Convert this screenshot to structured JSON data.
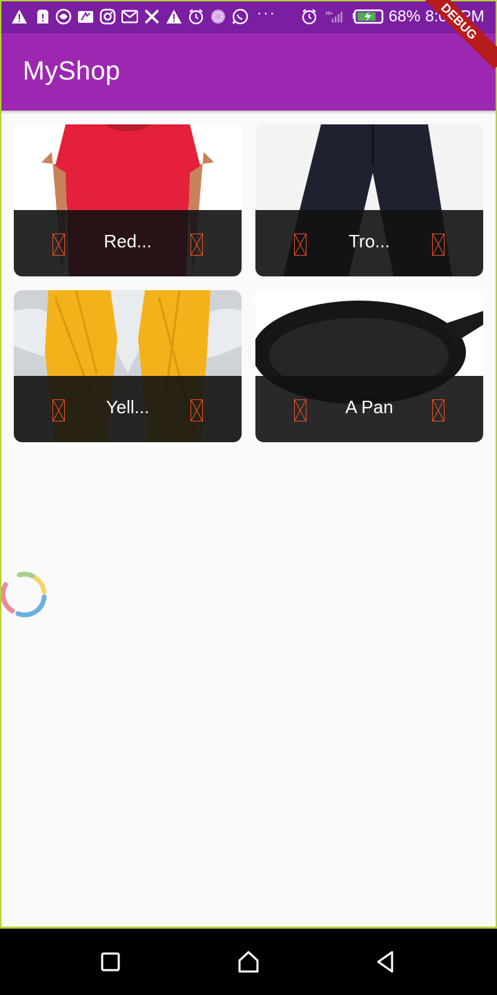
{
  "statusbar": {
    "battery_percent": "68%",
    "time": "8:02 PM",
    "notification_icons": [
      "warning-icon",
      "sim-alert-icon",
      "browser-icon",
      "sim-icon",
      "instagram-icon",
      "gmail-icon",
      "x-icon",
      "warning-icon",
      "alarm-icon",
      "sticker-icon",
      "whatsapp-icon",
      "more-icon"
    ],
    "system_icons": [
      "alarm-icon",
      "signal-icon",
      "battery-charging-icon"
    ]
  },
  "appbar": {
    "title": "MyShop"
  },
  "debug_banner": "DEBUG",
  "products": [
    {
      "title": "Red...",
      "image": "red-shirt",
      "left_icon": "favorite-icon",
      "right_icon": "cart-icon"
    },
    {
      "title": "Tro...",
      "image": "trousers",
      "left_icon": "favorite-icon",
      "right_icon": "cart-icon"
    },
    {
      "title": "Yell...",
      "image": "yellow-scarf",
      "left_icon": "favorite-icon",
      "right_icon": "cart-icon"
    },
    {
      "title": "A Pan",
      "image": "pan",
      "left_icon": "favorite-icon",
      "right_icon": "cart-icon"
    }
  ],
  "colors": {
    "statusbar": "#7b1fa2",
    "appbar": "#9c27b0",
    "background": "#fafafa",
    "icon_placeholder": "#e8502b",
    "frame": "#b5d334"
  },
  "navbar": {
    "buttons": [
      "recents-button",
      "home-button",
      "back-button"
    ]
  }
}
